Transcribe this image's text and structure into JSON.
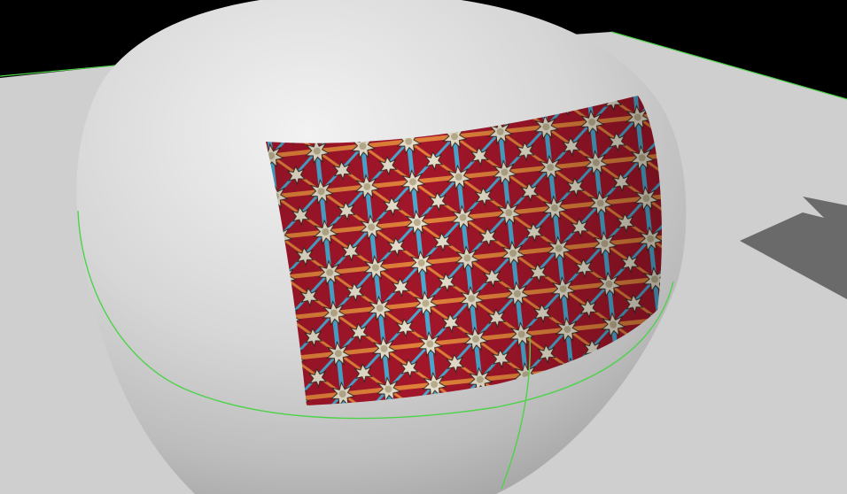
{
  "scene": {
    "background_color": "#000000",
    "ground_color": "#cfcfcf",
    "shadow_color": "#6a6a6a",
    "sphere_base_color": "#d2d2d2",
    "selection_color": "#4ed24a",
    "decal_colors": {
      "base": "#a3162a",
      "star": "#e6dfcc",
      "star_center": "#b9ad8c",
      "orange": "#e0803a",
      "blue": "#4aa8cf",
      "outline": "#3a2a20"
    }
  }
}
